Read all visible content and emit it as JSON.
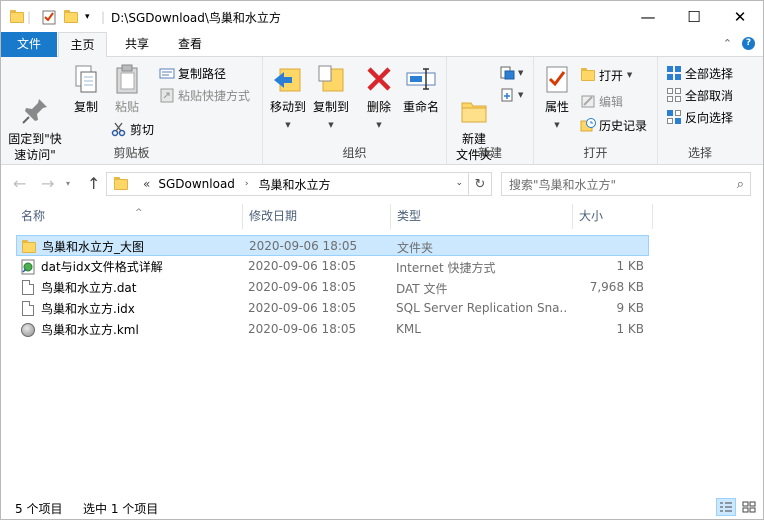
{
  "window": {
    "title": "D:\\SGDownload\\鸟巢和水立方",
    "minimize": "—",
    "maximize": "☐",
    "close": "✕"
  },
  "tabs": {
    "file": "文件",
    "home": "主页",
    "share": "共享",
    "view": "查看"
  },
  "ribbon": {
    "clipboard": {
      "label": "剪贴板",
      "pin": "固定到\"快\n速访问\"",
      "copy": "复制",
      "paste": "粘贴",
      "copy_path": "复制路径",
      "paste_shortcut": "粘贴快捷方式",
      "cut": "剪切"
    },
    "organize": {
      "label": "组织",
      "move_to": "移动到",
      "copy_to": "复制到",
      "delete": "删除",
      "rename": "重命名"
    },
    "new": {
      "label": "新建",
      "new_folder": "新建\n文件夹"
    },
    "open": {
      "label": "打开",
      "properties": "属性",
      "open": "打开",
      "edit": "编辑",
      "history": "历史记录"
    },
    "select": {
      "label": "选择",
      "select_all": "全部选择",
      "select_none": "全部取消",
      "invert": "反向选择"
    }
  },
  "address": {
    "crumbs": [
      "SGDownload",
      "鸟巢和水立方"
    ],
    "overflow": "«",
    "search_placeholder": "搜索\"鸟巢和水立方\""
  },
  "columns": {
    "name": "名称",
    "date": "修改日期",
    "type": "类型",
    "size": "大小"
  },
  "files": [
    {
      "name": "鸟巢和水立方_大图",
      "date": "2020-09-06 18:05",
      "type": "文件夹",
      "size": "",
      "icon": "folder-icon"
    },
    {
      "name": "dat与idx文件格式详解",
      "date": "2020-09-06 18:05",
      "type": "Internet 快捷方式",
      "size": "1 KB",
      "icon": "internet-shortcut-icon"
    },
    {
      "name": "鸟巢和水立方.dat",
      "date": "2020-09-06 18:05",
      "type": "DAT 文件",
      "size": "7,968 KB",
      "icon": "file-icon"
    },
    {
      "name": "鸟巢和水立方.idx",
      "date": "2020-09-06 18:05",
      "type": "SQL Server Replication Sna...",
      "size": "9 KB",
      "icon": "file-icon"
    },
    {
      "name": "鸟巢和水立方.kml",
      "date": "2020-09-06 18:05",
      "type": "KML",
      "size": "1 KB",
      "icon": "kml-globe-icon"
    }
  ],
  "status": {
    "count": "5 个项目",
    "selected": "选中 1 个项目"
  },
  "colors": {
    "accent": "#1979ca",
    "selection": "#cce8ff",
    "selection_border": "#99d1ff"
  }
}
